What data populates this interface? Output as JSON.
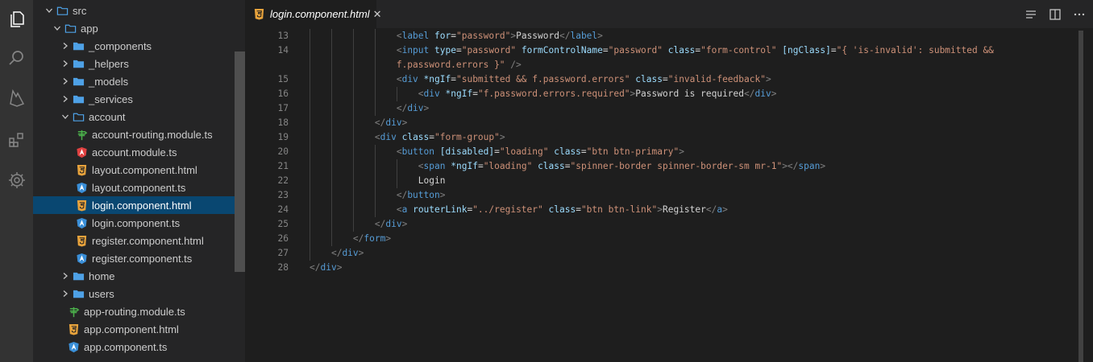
{
  "explorer": {
    "items": [
      {
        "label": "src",
        "depth": 0,
        "expanded": true,
        "kind": "folder-open"
      },
      {
        "label": "app",
        "depth": 1,
        "expanded": true,
        "kind": "folder-open"
      },
      {
        "label": "_components",
        "depth": 2,
        "expanded": false,
        "kind": "folder"
      },
      {
        "label": "_helpers",
        "depth": 2,
        "expanded": false,
        "kind": "folder"
      },
      {
        "label": "_models",
        "depth": 2,
        "expanded": false,
        "kind": "folder"
      },
      {
        "label": "_services",
        "depth": 2,
        "expanded": false,
        "kind": "folder"
      },
      {
        "label": "account",
        "depth": 2,
        "expanded": true,
        "kind": "folder-open"
      },
      {
        "label": "account-routing.module.ts",
        "depth": 3,
        "kind": "routing-file"
      },
      {
        "label": "account.module.ts",
        "depth": 3,
        "kind": "angular-module-file"
      },
      {
        "label": "layout.component.html",
        "depth": 3,
        "kind": "html-file"
      },
      {
        "label": "layout.component.ts",
        "depth": 3,
        "kind": "angular-ts-file"
      },
      {
        "label": "login.component.html",
        "depth": 3,
        "kind": "html-file",
        "selected": true
      },
      {
        "label": "login.component.ts",
        "depth": 3,
        "kind": "angular-ts-file"
      },
      {
        "label": "register.component.html",
        "depth": 3,
        "kind": "html-file"
      },
      {
        "label": "register.component.ts",
        "depth": 3,
        "kind": "angular-ts-file"
      },
      {
        "label": "home",
        "depth": 2,
        "expanded": false,
        "kind": "folder"
      },
      {
        "label": "users",
        "depth": 2,
        "expanded": false,
        "kind": "folder"
      },
      {
        "label": "app-routing.module.ts",
        "depth": 2,
        "kind": "routing-file"
      },
      {
        "label": "app.component.html",
        "depth": 2,
        "kind": "html-file"
      },
      {
        "label": "app.component.ts",
        "depth": 2,
        "kind": "angular-ts-file"
      }
    ]
  },
  "tab": {
    "label": "login.component.html",
    "close": "✕",
    "icon": "html-file-icon"
  },
  "editor_actions": [
    "open-changes-icon",
    "split-editor-icon",
    "more-actions-icon"
  ],
  "code": [
    {
      "n": "13",
      "indent": 4,
      "tokens": [
        [
          "tb",
          "<"
        ],
        [
          "tag",
          "label"
        ],
        [
          "txt",
          " "
        ],
        [
          "attr",
          "for"
        ],
        [
          "txt",
          "="
        ],
        [
          "str",
          "\"password\""
        ],
        [
          "tb",
          ">"
        ],
        [
          "txt",
          "Password"
        ],
        [
          "tb",
          "</"
        ],
        [
          "tag",
          "label"
        ],
        [
          "tb",
          ">"
        ]
      ]
    },
    {
      "n": "14",
      "indent": 4,
      "tokens": [
        [
          "tb",
          "<"
        ],
        [
          "tag",
          "input"
        ],
        [
          "txt",
          " "
        ],
        [
          "attr",
          "type"
        ],
        [
          "txt",
          "="
        ],
        [
          "str",
          "\"password\""
        ],
        [
          "txt",
          " "
        ],
        [
          "attr",
          "formControlName"
        ],
        [
          "txt",
          "="
        ],
        [
          "str",
          "\"password\""
        ],
        [
          "txt",
          " "
        ],
        [
          "attr",
          "class"
        ],
        [
          "txt",
          "="
        ],
        [
          "str",
          "\"form-control\""
        ],
        [
          "txt",
          " "
        ],
        [
          "attr",
          "[ngClass]"
        ],
        [
          "txt",
          "="
        ],
        [
          "str",
          "\"{ 'is-invalid': submitted &&"
        ]
      ]
    },
    {
      "n": "",
      "indent": 4,
      "tokens": [
        [
          "str",
          "f.password.errors }\""
        ],
        [
          "txt",
          " "
        ],
        [
          "tb",
          "/>"
        ]
      ]
    },
    {
      "n": "15",
      "indent": 4,
      "tokens": [
        [
          "tb",
          "<"
        ],
        [
          "tag",
          "div"
        ],
        [
          "txt",
          " "
        ],
        [
          "attr",
          "*ngIf"
        ],
        [
          "txt",
          "="
        ],
        [
          "str",
          "\"submitted && f.password.errors\""
        ],
        [
          "txt",
          " "
        ],
        [
          "attr",
          "class"
        ],
        [
          "txt",
          "="
        ],
        [
          "str",
          "\"invalid-feedback\""
        ],
        [
          "tb",
          ">"
        ]
      ]
    },
    {
      "n": "16",
      "indent": 5,
      "tokens": [
        [
          "tb",
          "<"
        ],
        [
          "tag",
          "div"
        ],
        [
          "txt",
          " "
        ],
        [
          "attr",
          "*ngIf"
        ],
        [
          "txt",
          "="
        ],
        [
          "str",
          "\"f.password.errors.required\""
        ],
        [
          "tb",
          ">"
        ],
        [
          "txt",
          "Password is required"
        ],
        [
          "tb",
          "</"
        ],
        [
          "tag",
          "div"
        ],
        [
          "tb",
          ">"
        ]
      ]
    },
    {
      "n": "17",
      "indent": 4,
      "tokens": [
        [
          "tb",
          "</"
        ],
        [
          "tag",
          "div"
        ],
        [
          "tb",
          ">"
        ]
      ]
    },
    {
      "n": "18",
      "indent": 3,
      "tokens": [
        [
          "tb",
          "</"
        ],
        [
          "tag",
          "div"
        ],
        [
          "tb",
          ">"
        ]
      ]
    },
    {
      "n": "19",
      "indent": 3,
      "tokens": [
        [
          "tb",
          "<"
        ],
        [
          "tag",
          "div"
        ],
        [
          "txt",
          " "
        ],
        [
          "attr",
          "class"
        ],
        [
          "txt",
          "="
        ],
        [
          "str",
          "\"form-group\""
        ],
        [
          "tb",
          ">"
        ]
      ]
    },
    {
      "n": "20",
      "indent": 4,
      "tokens": [
        [
          "tb",
          "<"
        ],
        [
          "tag",
          "button"
        ],
        [
          "txt",
          " "
        ],
        [
          "attr",
          "[disabled]"
        ],
        [
          "txt",
          "="
        ],
        [
          "str",
          "\"loading\""
        ],
        [
          "txt",
          " "
        ],
        [
          "attr",
          "class"
        ],
        [
          "txt",
          "="
        ],
        [
          "str",
          "\"btn btn-primary\""
        ],
        [
          "tb",
          ">"
        ]
      ]
    },
    {
      "n": "21",
      "indent": 5,
      "tokens": [
        [
          "tb",
          "<"
        ],
        [
          "tag",
          "span"
        ],
        [
          "txt",
          " "
        ],
        [
          "attr",
          "*ngIf"
        ],
        [
          "txt",
          "="
        ],
        [
          "str",
          "\"loading\""
        ],
        [
          "txt",
          " "
        ],
        [
          "attr",
          "class"
        ],
        [
          "txt",
          "="
        ],
        [
          "str",
          "\"spinner-border spinner-border-sm mr-1\""
        ],
        [
          "tb",
          "></"
        ],
        [
          "tag",
          "span"
        ],
        [
          "tb",
          ">"
        ]
      ]
    },
    {
      "n": "22",
      "indent": 5,
      "tokens": [
        [
          "txt",
          "Login"
        ]
      ]
    },
    {
      "n": "23",
      "indent": 4,
      "tokens": [
        [
          "tb",
          "</"
        ],
        [
          "tag",
          "button"
        ],
        [
          "tb",
          ">"
        ]
      ]
    },
    {
      "n": "24",
      "indent": 4,
      "tokens": [
        [
          "tb",
          "<"
        ],
        [
          "tag",
          "a"
        ],
        [
          "txt",
          " "
        ],
        [
          "attr",
          "routerLink"
        ],
        [
          "txt",
          "="
        ],
        [
          "str",
          "\"../register\""
        ],
        [
          "txt",
          " "
        ],
        [
          "attr",
          "class"
        ],
        [
          "txt",
          "="
        ],
        [
          "str",
          "\"btn btn-link\""
        ],
        [
          "tb",
          ">"
        ],
        [
          "txt",
          "Register"
        ],
        [
          "tb",
          "</"
        ],
        [
          "tag",
          "a"
        ],
        [
          "tb",
          ">"
        ]
      ]
    },
    {
      "n": "25",
      "indent": 3,
      "tokens": [
        [
          "tb",
          "</"
        ],
        [
          "tag",
          "div"
        ],
        [
          "tb",
          ">"
        ]
      ]
    },
    {
      "n": "26",
      "indent": 2,
      "tokens": [
        [
          "tb",
          "</"
        ],
        [
          "tag",
          "form"
        ],
        [
          "tb",
          ">"
        ]
      ]
    },
    {
      "n": "27",
      "indent": 1,
      "tokens": [
        [
          "tb",
          "</"
        ],
        [
          "tag",
          "div"
        ],
        [
          "tb",
          ">"
        ]
      ]
    },
    {
      "n": "28",
      "indent": 0,
      "tokens": [
        [
          "tb",
          "</"
        ],
        [
          "tag",
          "div"
        ],
        [
          "tb",
          ">"
        ]
      ]
    }
  ],
  "colors": {
    "activity_bar": "#333333",
    "sidebar": "#252526",
    "editor": "#1e1e1e",
    "selection": "#094771",
    "folder": "#4ea1e6",
    "html_icon": "#e8a33c",
    "angular_icon": "#e04141",
    "angular_ts_icon": "#3a8fd8",
    "routing_icon": "#4bb04b"
  }
}
